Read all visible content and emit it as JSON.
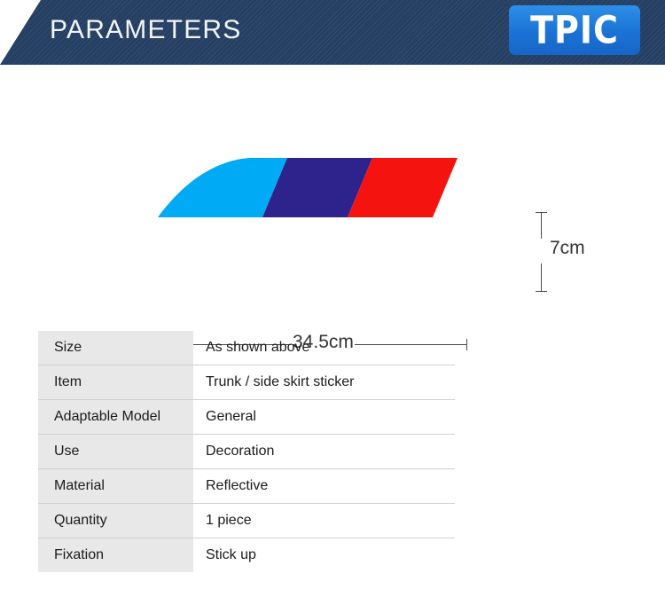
{
  "header": {
    "title": "PARAMETERS",
    "logo_text": "TPIC",
    "logo_bg": "#1b72d4",
    "banner_bg": "#233f65"
  },
  "product": {
    "sticker_alt": "three-stripe parallelogram sticker",
    "stripes": [
      {
        "name": "cyan-stripe",
        "color": "#00aaf5"
      },
      {
        "name": "indigo-stripe",
        "color": "#2e228c"
      },
      {
        "name": "red-stripe",
        "color": "#f51310"
      }
    ],
    "dimensions": {
      "height_label": "7cm",
      "width_label": "34.5cm"
    }
  },
  "spec_table": {
    "rows": [
      {
        "label": "Size",
        "value": "As shown above"
      },
      {
        "label": "Item",
        "value": "Trunk / side  skirt  sticker"
      },
      {
        "label": "Adaptable Model",
        "value": "General"
      },
      {
        "label": "Use",
        "value": "Decoration"
      },
      {
        "label": "Material",
        "value": "Reflective"
      },
      {
        "label": "Quantity",
        "value": "1 piece"
      },
      {
        "label": "Fixation",
        "value": "Stick up"
      }
    ]
  }
}
